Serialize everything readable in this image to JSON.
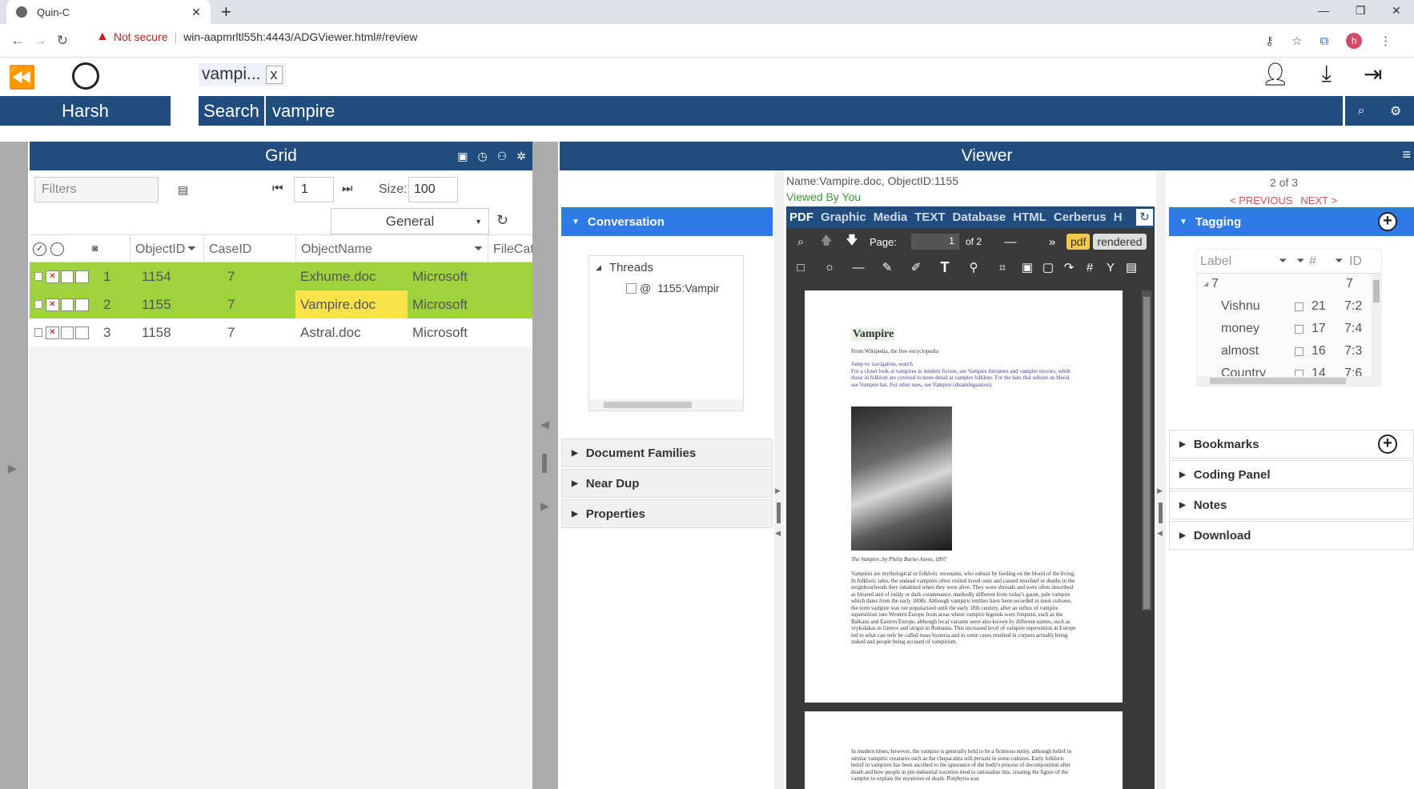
{
  "browser": {
    "tab_title": "Quin-C",
    "new_tab": "+",
    "security": "Not secure",
    "url": "win-aapmrltl55h:4443/ADGViewer.html#/review",
    "profile_initial": "h"
  },
  "header": {
    "search_chip": "vampi...",
    "chip_close": "x"
  },
  "bar": {
    "user": "Harsh",
    "search_label": "Search",
    "search_value": "vampire"
  },
  "grid": {
    "title": "Grid",
    "filters_placeholder": "Filters",
    "page": "1",
    "size_label": "Size:",
    "size": "100",
    "view_select": "General",
    "columns": [
      "ObjectID",
      "CaseID",
      "ObjectName",
      "FileCateg"
    ],
    "rows": [
      {
        "num": "1",
        "id": "1154",
        "case": "7",
        "name": "Exhume.doc",
        "cat": "Microsoft"
      },
      {
        "num": "2",
        "id": "1155",
        "case": "7",
        "name": "Vampire.doc",
        "cat": "Microsoft"
      },
      {
        "num": "3",
        "id": "1158",
        "case": "7",
        "name": "Astral.doc",
        "cat": "Microsoft"
      }
    ]
  },
  "viewer": {
    "title": "Viewer",
    "doc_name": "Name:Vampire.doc, ObjectID:1155",
    "viewed_by": "Viewed By You",
    "tabs": [
      "PDF",
      "Graphic",
      "Media",
      "TEXT",
      "Database",
      "HTML",
      "Cerberus",
      "H"
    ],
    "page_label": "Page:",
    "page_value": "1",
    "page_of": "of 2",
    "pdf_btn": "pdf",
    "rendered_btn": "rendered",
    "doc": {
      "heading": "Vampire",
      "from": "From Wikipedia, the free encyclopedia",
      "caption": "The Vampire, by Philip Burne-Jones, 1897",
      "para1": "Jump to: navigation, search\nFor a closer look at vampires in modern fiction, see Vampire literature and vampire movies, while those in folklore are covered in more detail at vampire folklore. For the bats that subsist on blood, see Vampire bat. For other uses, see Vampire (disambiguation).",
      "para2": "Vampires are mythological or folkloric revenants, who subsist by feeding on the blood of the living. In folkloric tales, the undead vampires often visited loved ones and caused mischief or deaths in the neighbourhoods they inhabited when they were alive. They wore shrouds and were often described as bloated and of ruddy or dark countenance, markedly different from today's gaunt, pale vampire which dates from the early 1800s. Although vampiric entities have been recorded in most cultures, the term vampire was not popularized until the early 18th century, after an influx of vampire superstition into Western Europe from areas where vampire legends were frequent, such as the Balkans and Eastern Europe, although local variants were also known by different names, such as vrykolakas in Greece and strigoi in Romania. This increased level of vampire superstition in Europe led to what can only be called mass hysteria and in some cases resulted in corpses actually being staked and people being accused of vampirism.",
      "para3": "In modern times, however, the vampire is generally held to be a fictitious entity, although belief in similar vampiric creatures such as the chupacabra still persists in some cultures. Early folkloric belief in vampires has been ascribed to the ignorance of the body's process of decomposition after death and how people in pre-industrial societies tried to rationalise this, creating the figure of the vampire to explain the mysteries of death. Porphyria was"
    }
  },
  "conversation": {
    "title": "Conversation",
    "threads_label": "Threads",
    "thread_item": "1155:Vampir"
  },
  "left_sections": [
    "Document Families",
    "Near Dup",
    "Properties"
  ],
  "right": {
    "counter": "2 of 3",
    "previous": "< PREVIOUS",
    "next": "NEXT >",
    "tagging": "Tagging",
    "tag_cols": [
      "Label",
      "#",
      "ID"
    ],
    "tag_group": "7",
    "tag_group_id": "7",
    "tags": [
      {
        "label": "Vishnu",
        "count": "21",
        "id": "7:2"
      },
      {
        "label": "money",
        "count": "17",
        "id": "7:4"
      },
      {
        "label": "almost",
        "count": "16",
        "id": "7:3"
      },
      {
        "label": "Country",
        "count": "14",
        "id": "7:6"
      }
    ],
    "sections": [
      "Bookmarks",
      "Coding Panel",
      "Notes",
      "Download"
    ]
  },
  "colors": {
    "brand": "#204d7e",
    "active": "#2f7be6",
    "row_green": "#9fd33d",
    "row_yellow": "#f8e34a"
  }
}
